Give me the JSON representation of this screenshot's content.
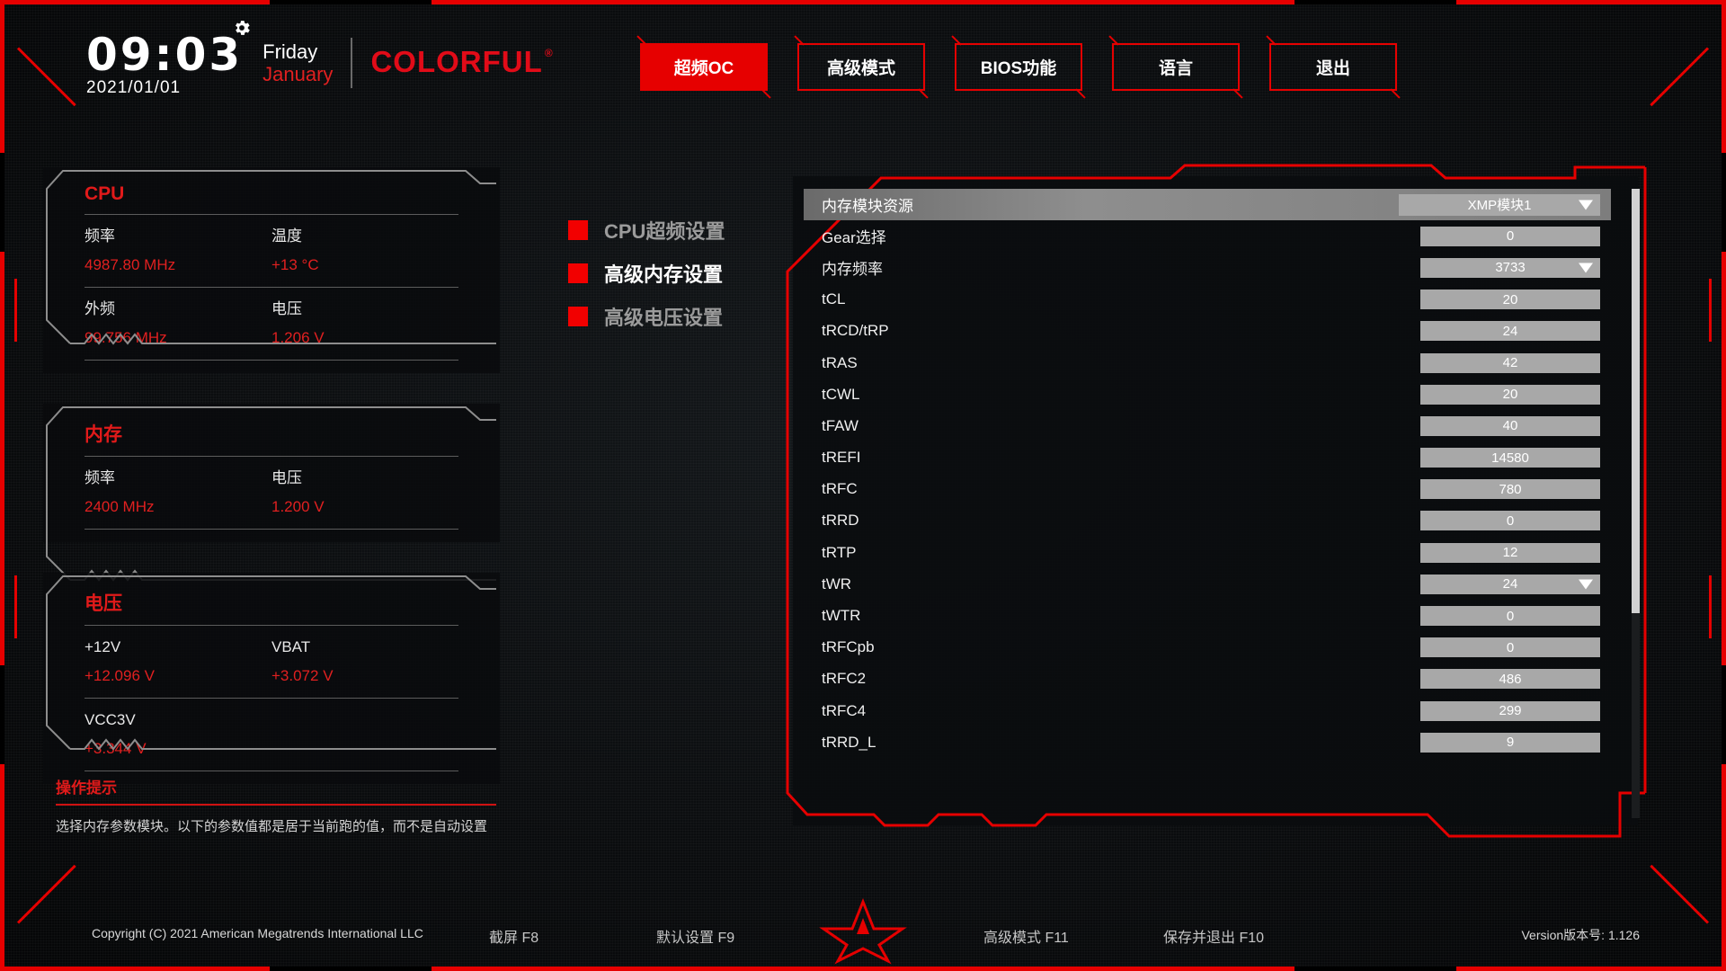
{
  "header": {
    "time": "09:03",
    "date": "2021/01/01",
    "day": "Friday",
    "month": "January",
    "brand": "COLORFUL",
    "brand_mark": "®",
    "gear_icon": "gear-icon"
  },
  "nav": {
    "items": [
      {
        "label": "超频OC",
        "active": true
      },
      {
        "label": "高级模式",
        "active": false
      },
      {
        "label": "BIOS功能",
        "active": false
      },
      {
        "label": "语言",
        "active": false
      },
      {
        "label": "退出",
        "active": false
      }
    ]
  },
  "cards": [
    {
      "title": "CPU",
      "rows": [
        [
          {
            "label": "频率",
            "value": "4987.80 MHz"
          },
          {
            "label": "温度",
            "value": "+13 °C"
          }
        ],
        [
          {
            "label": "外频",
            "value": "99.756 MHz"
          },
          {
            "label": "电压",
            "value": "1.206 V"
          }
        ]
      ]
    },
    {
      "title": "内存",
      "rows": [
        [
          {
            "label": "频率",
            "value": "2400 MHz"
          },
          {
            "label": "电压",
            "value": "1.200 V"
          }
        ]
      ]
    },
    {
      "title": "电压",
      "rows": [
        [
          {
            "label": "+12V",
            "value": "+12.096 V"
          },
          {
            "label": "VBAT",
            "value": "+3.072 V"
          }
        ],
        [
          {
            "label": "VCC3V",
            "value": "+3.344 V"
          },
          {
            "label": "",
            "value": ""
          }
        ]
      ]
    }
  ],
  "midmenu": {
    "items": [
      {
        "label": "CPU超频设置",
        "active": false
      },
      {
        "label": "高级内存设置",
        "active": true
      },
      {
        "label": "高级电压设置",
        "active": false
      }
    ]
  },
  "hint": {
    "title": "操作提示",
    "text": "选择内存参数模块。以下的参数值都是居于当前跑的值，而不是自动设置"
  },
  "settings": {
    "rows": [
      {
        "label": "内存模块资源",
        "value": "XMP模块1",
        "dropdown": true,
        "selected": true
      },
      {
        "label": "Gear选择",
        "value": "0",
        "dropdown": false,
        "selected": false
      },
      {
        "label": "内存频率",
        "value": "3733",
        "dropdown": true,
        "selected": false
      },
      {
        "label": "tCL",
        "value": "20",
        "dropdown": false,
        "selected": false
      },
      {
        "label": "tRCD/tRP",
        "value": "24",
        "dropdown": false,
        "selected": false
      },
      {
        "label": "tRAS",
        "value": "42",
        "dropdown": false,
        "selected": false
      },
      {
        "label": "tCWL",
        "value": "20",
        "dropdown": false,
        "selected": false
      },
      {
        "label": "tFAW",
        "value": "40",
        "dropdown": false,
        "selected": false
      },
      {
        "label": "tREFI",
        "value": "14580",
        "dropdown": false,
        "selected": false
      },
      {
        "label": "tRFC",
        "value": "780",
        "dropdown": false,
        "selected": false
      },
      {
        "label": "tRRD",
        "value": "0",
        "dropdown": false,
        "selected": false
      },
      {
        "label": "tRTP",
        "value": "12",
        "dropdown": false,
        "selected": false
      },
      {
        "label": "tWR",
        "value": "24",
        "dropdown": true,
        "selected": false
      },
      {
        "label": "tWTR",
        "value": "0",
        "dropdown": false,
        "selected": false
      },
      {
        "label": "tRFCpb",
        "value": "0",
        "dropdown": false,
        "selected": false
      },
      {
        "label": "tRFC2",
        "value": "486",
        "dropdown": false,
        "selected": false
      },
      {
        "label": "tRFC4",
        "value": "299",
        "dropdown": false,
        "selected": false
      },
      {
        "label": "tRRD_L",
        "value": "9",
        "dropdown": false,
        "selected": false
      }
    ]
  },
  "footer": {
    "copyright": "Copyright (C) 2021 American Megatrends International LLC",
    "keys": [
      {
        "label": "截屏 F8"
      },
      {
        "label": "默认设置 F9"
      },
      {
        "label": "高级模式 F11"
      },
      {
        "label": "保存并退出 F10"
      }
    ],
    "version": "Version版本号: 1.126",
    "logo_icon": "star-logo-icon"
  },
  "colors": {
    "accent_red": "#e60000",
    "value_red": "#e02020",
    "field_gray": "#a8a8a8",
    "background": "#0b0d0f"
  }
}
